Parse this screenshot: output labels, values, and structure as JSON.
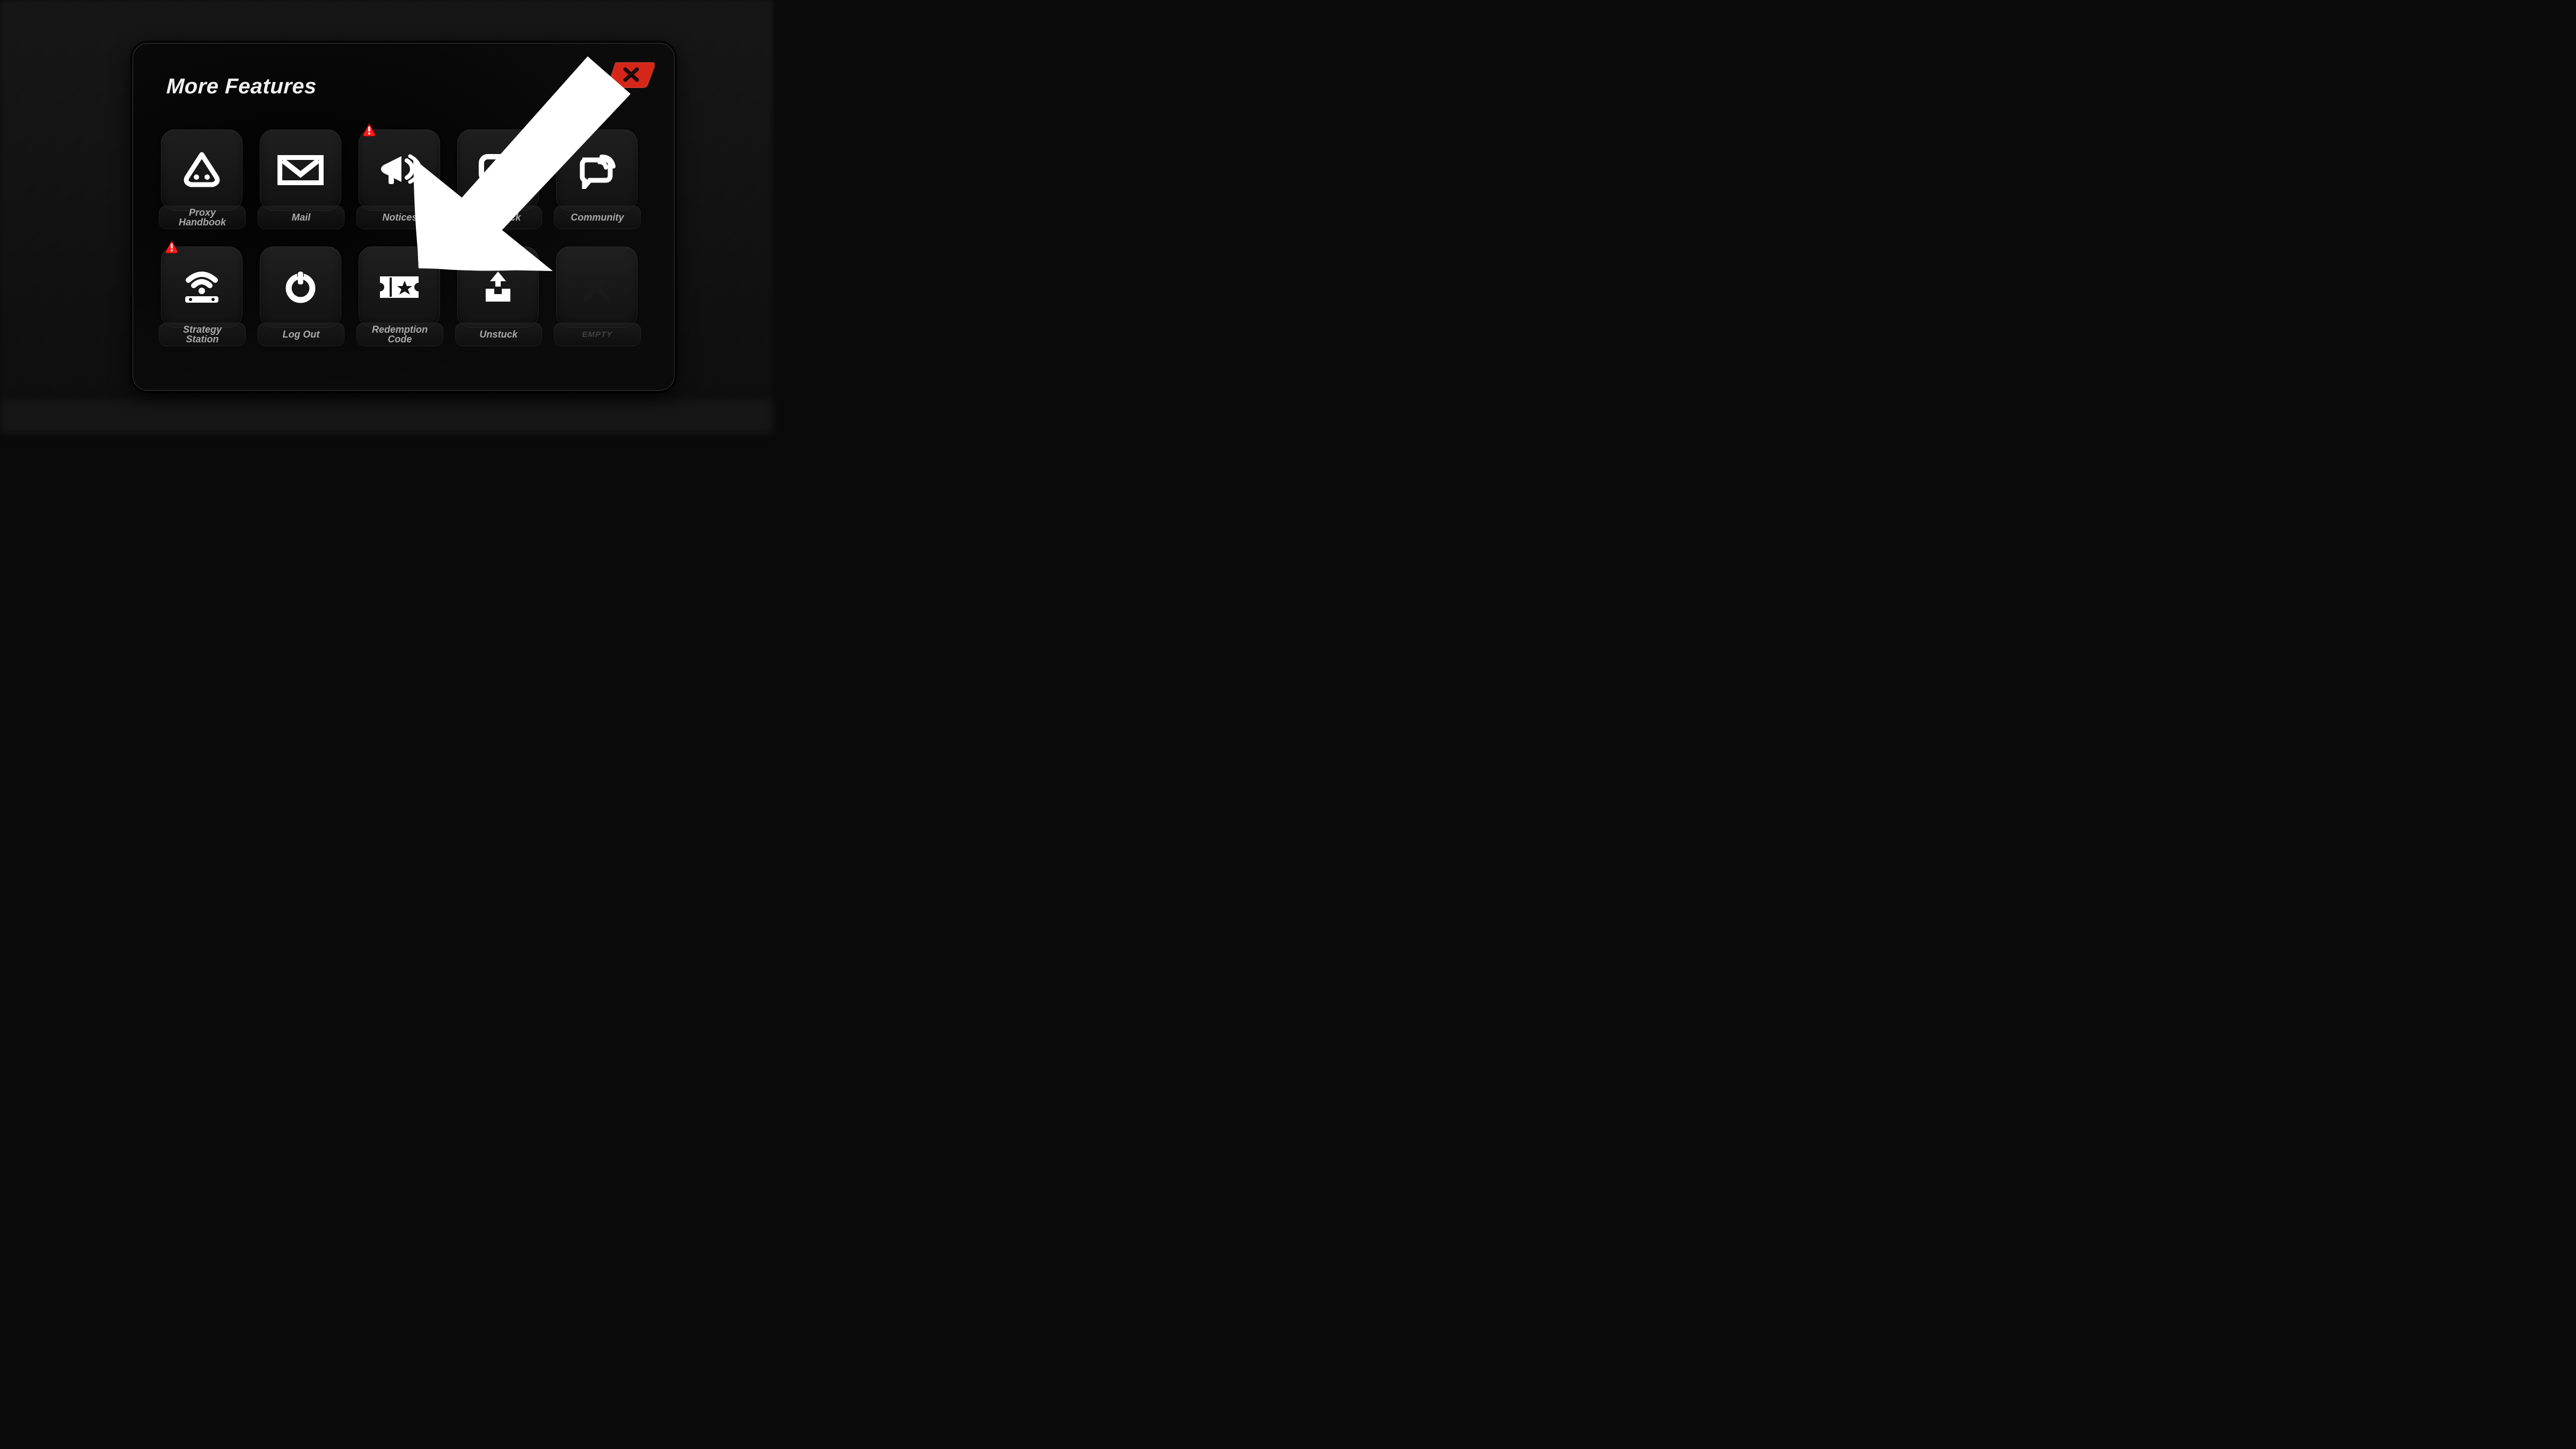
{
  "modal": {
    "title": "More Features",
    "close_label": "Close"
  },
  "tiles": [
    {
      "label": "Proxy\nHandbook",
      "icon": "proxy-handbook-icon",
      "badge": false,
      "empty": false
    },
    {
      "label": "Mail",
      "icon": "mail-icon",
      "badge": false,
      "empty": false
    },
    {
      "label": "Notices",
      "icon": "megaphone-icon",
      "badge": true,
      "empty": false
    },
    {
      "label": "Feedback",
      "icon": "feedback-icon",
      "badge": false,
      "empty": false
    },
    {
      "label": "Community",
      "icon": "community-icon",
      "badge": false,
      "empty": false
    },
    {
      "label": "Strategy\nStation",
      "icon": "wifi-station-icon",
      "badge": true,
      "empty": false
    },
    {
      "label": "Log Out",
      "icon": "power-icon",
      "badge": false,
      "empty": false
    },
    {
      "label": "Redemption\nCode",
      "icon": "ticket-icon",
      "badge": false,
      "empty": false
    },
    {
      "label": "Unstuck",
      "icon": "unstuck-icon",
      "badge": false,
      "empty": false
    },
    {
      "label": "EMPTY",
      "icon": "x-slot-icon",
      "badge": false,
      "empty": true
    }
  ],
  "colors": {
    "accent_red": "#ff2a1f",
    "badge_red": "#ff1a1a",
    "text_muted": "#a9a9a9"
  },
  "annotation": {
    "arrow_target": "Redemption Code"
  }
}
